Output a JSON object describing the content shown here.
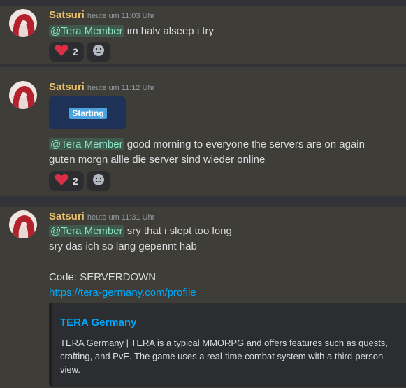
{
  "messages": [
    {
      "username": "Satsuri",
      "timestamp": "heute um 11:03 Uhr",
      "mention": "@Tera Member",
      "text": "im halv alseep i try",
      "reactions": [
        {
          "emoji": "heart-icon",
          "count": "2"
        }
      ]
    },
    {
      "username": "Satsuri",
      "timestamp": "heute um 11:12 Uhr",
      "badge": "Starting",
      "mention": "@Tera Member",
      "text": "good morning to everyone the servers are on again",
      "text2": "guten morgn allle die server sind wieder online",
      "reactions": [
        {
          "emoji": "heart-icon",
          "count": "2"
        }
      ]
    },
    {
      "username": "Satsuri",
      "timestamp": "heute um 11:31 Uhr",
      "mention": "@Tera Member",
      "text": "sry that i slept too long",
      "text2": "sry das ich so lang gepennt hab",
      "code_line": "Code: SERVERDOWN",
      "link": "https://tera-germany.com/profile",
      "embed": {
        "title": "TERA Germany",
        "description": "TERA Germany | TERA is a typical MMORPG and offers features such as quests, crafting, and PvE. The game uses a real-time combat system with a third-person view."
      }
    }
  ],
  "colors": {
    "username": "#e8c06a",
    "mention_text": "#8fe3c8",
    "link": "#00a8fc",
    "message_bg": "#3f3d37",
    "separator_bg": "#313338"
  }
}
